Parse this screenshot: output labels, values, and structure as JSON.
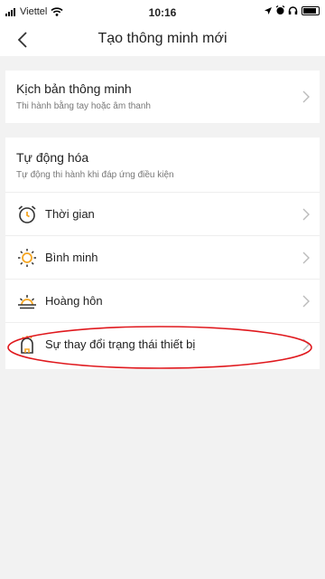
{
  "status_bar": {
    "carrier": "Viettel",
    "time": "10:16"
  },
  "nav": {
    "title": "Tạo thông minh mới"
  },
  "manual_section": {
    "title": "Kịch bản thông minh",
    "subtitle": "Thi hành bằng tay hoặc âm thanh"
  },
  "automation_section": {
    "title": "Tự động hóa",
    "subtitle": "Tự động thi hành khi đáp ứng điều kiện",
    "items": [
      {
        "label": "Thời gian",
        "icon": "alarm-clock-icon"
      },
      {
        "label": "Bình minh",
        "icon": "sunrise-icon"
      },
      {
        "label": "Hoàng hôn",
        "icon": "sunset-icon"
      },
      {
        "label": "Sự thay đổi trạng thái thiết bị",
        "icon": "device-status-icon"
      }
    ]
  },
  "colors": {
    "accent": "#f5a623",
    "highlight": "#e0191e",
    "background": "#f2f2f2"
  }
}
